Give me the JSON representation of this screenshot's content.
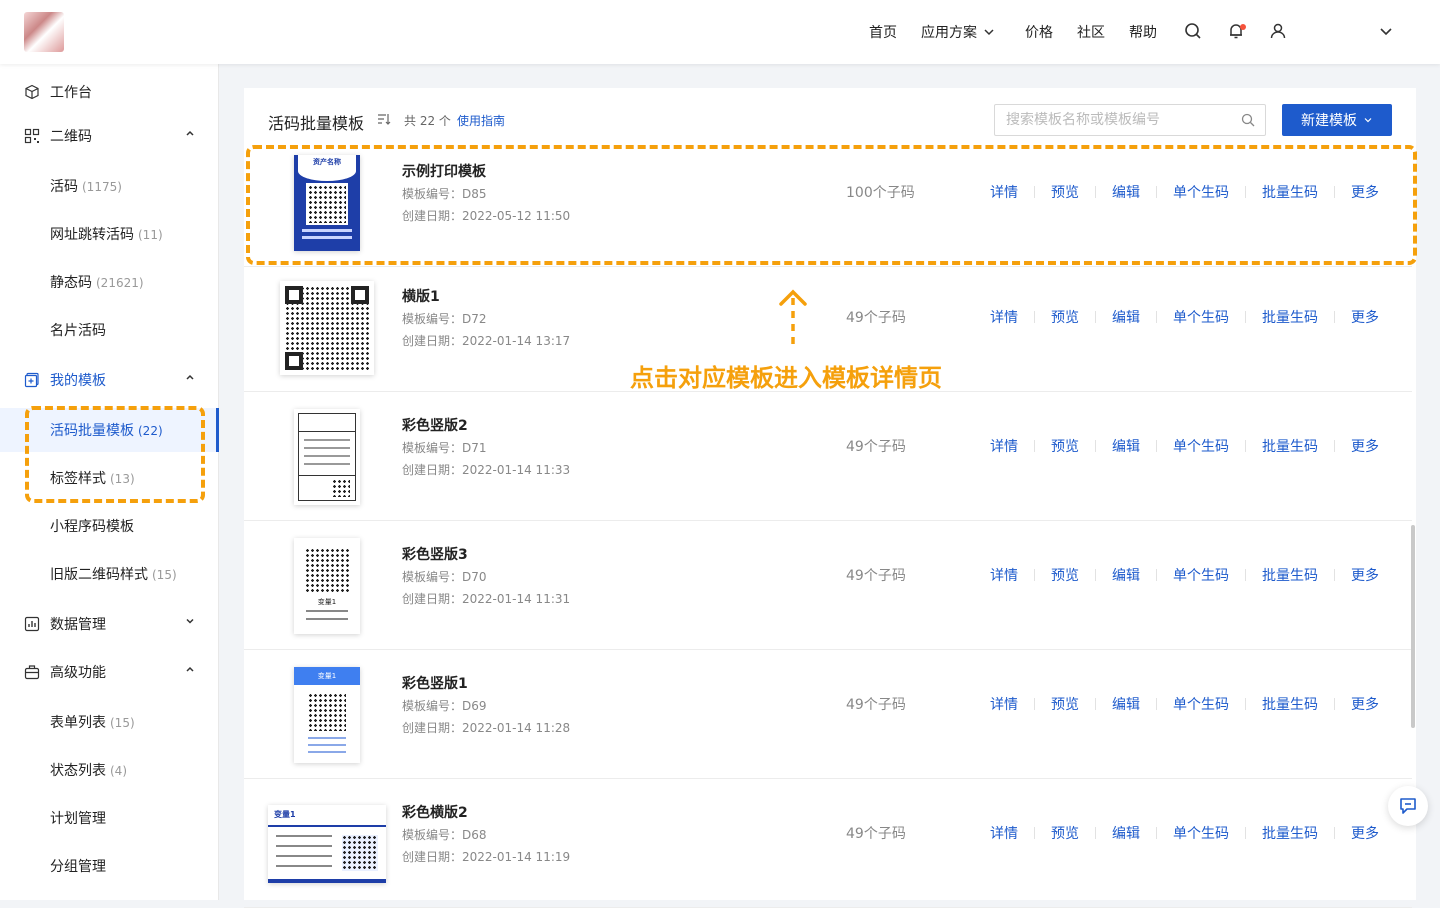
{
  "topnav": {
    "home": "首页",
    "solutions": "应用方案",
    "pricing": "价格",
    "community": "社区",
    "help": "帮助"
  },
  "sidebar": {
    "workbench": "工作台",
    "qrcode": "二维码",
    "live_code": {
      "label": "活码",
      "count": "(1175)"
    },
    "url_jump": {
      "label": "网址跳转活码",
      "count": "(11)"
    },
    "static_code": {
      "label": "静态码",
      "count": "(21621)"
    },
    "card_code": "名片活码",
    "my_templates": "我的模板",
    "batch_templates": {
      "label": "活码批量模板",
      "count": "(22)"
    },
    "label_style": {
      "label": "标签样式",
      "count": "(13)"
    },
    "mini_program": "小程序码模板",
    "old_qr_style": {
      "label": "旧版二维码样式",
      "count": "(15)"
    },
    "data_mgmt": "数据管理",
    "advanced": "高级功能",
    "form_list": {
      "label": "表单列表",
      "count": "(15)"
    },
    "status_list": {
      "label": "状态列表",
      "count": "(4)"
    },
    "plan_mgmt": "计划管理",
    "group_mgmt": "分组管理"
  },
  "main": {
    "title": "活码批量模板",
    "total": "共 22 个",
    "guide": "使用指南",
    "search_placeholder": "搜索模板名称或模板编号",
    "new_button": "新建模板"
  },
  "actions": [
    "详情",
    "预览",
    "编辑",
    "单个生码",
    "批量生码",
    "更多"
  ],
  "templates": [
    {
      "name": "示例打印模板",
      "code": "模板编号：D85",
      "date": "创建日期：2022-05-12 11:50",
      "count": "100个子码"
    },
    {
      "name": "横版1",
      "code": "模板编号：D72",
      "date": "创建日期：2022-01-14 13:17",
      "count": "49个子码"
    },
    {
      "name": "彩色竖版2",
      "code": "模板编号：D71",
      "date": "创建日期：2022-01-14 11:33",
      "count": "49个子码"
    },
    {
      "name": "彩色竖版3",
      "code": "模板编号：D70",
      "date": "创建日期：2022-01-14 11:31",
      "count": "49个子码"
    },
    {
      "name": "彩色竖版1",
      "code": "模板编号：D69",
      "date": "创建日期：2022-01-14 11:28",
      "count": "49个子码"
    },
    {
      "name": "彩色横版2",
      "code": "模板编号：D68",
      "date": "创建日期：2022-01-14 11:19",
      "count": "49个子码"
    }
  ],
  "thumb_text": {
    "asset_name": "资产名称",
    "var1": "变量1"
  },
  "annotation": "点击对应模板进入模板详情页",
  "colors": {
    "accent": "#1e5bcc",
    "highlight": "#f5a00c",
    "notify": "#f5523b"
  }
}
